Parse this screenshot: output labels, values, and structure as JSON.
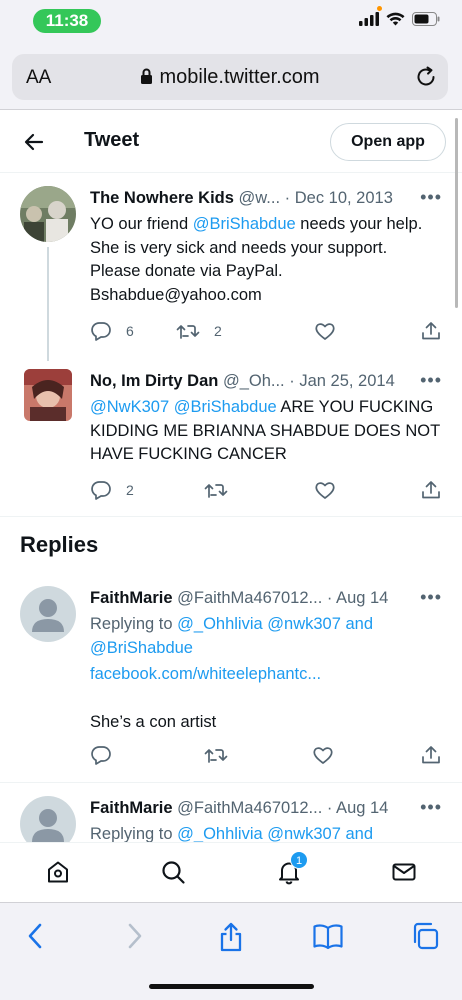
{
  "status_bar": {
    "time": "11:38",
    "time_color": "#34c759"
  },
  "browser": {
    "text_size_label": "AA",
    "url": "mobile.twitter.com"
  },
  "header": {
    "title": "Tweet",
    "open_app_label": "Open app"
  },
  "tweets": [
    {
      "name": "The Nowhere Kids",
      "handle": "@w...",
      "date": "· Dec 10, 2013",
      "text_before": "YO our friend ",
      "mention": "@BriShabdue",
      "text_after": " needs your help. She is very sick and needs your support. Please donate via PayPal. Bshabdue@yahoo.com",
      "reply_count": "6",
      "retweet_count": "2"
    },
    {
      "name": "No, Im Dirty Dan",
      "handle": "@_Oh...",
      "date": "· Jan 25, 2014",
      "mention1": "@NwK307",
      "mention2": "@BriShabdue",
      "text": " ARE YOU FUCKING KIDDING ME BRIANNA SHABDUE DOES NOT HAVE FUCKING CANCER",
      "reply_count": "2"
    }
  ],
  "replies_title": "Replies",
  "replies": [
    {
      "name": "FaithMarie",
      "handle": "@FaithMa467012...",
      "date": "· Aug 14",
      "replying_to_label": "Replying to ",
      "replying_to_users": "@_Ohhlivia @nwk307 and @BriShabdue",
      "link": "facebook.com/whiteelephantc...",
      "text": "She’s a con artist"
    },
    {
      "name": "FaithMarie",
      "handle": "@FaithMa467012...",
      "date": "· Aug 14",
      "replying_to_label": "Replying to ",
      "replying_to_users": "@_Ohhlivia @nwk307 and"
    }
  ],
  "tabbar": {
    "notification_badge": "1",
    "active_icon": "home-icon"
  },
  "colors": {
    "accent": "#1d9bf0",
    "text": "#0f1419",
    "secondary": "#536471"
  }
}
